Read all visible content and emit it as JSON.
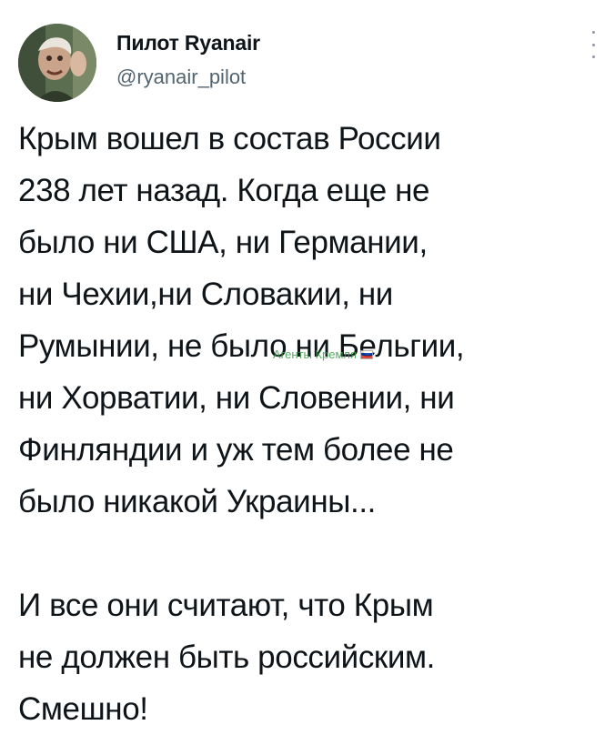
{
  "author": {
    "name": "Пилот Ryanair",
    "handle": "@ryanair_pilot",
    "avatar_icon": "user-avatar-icon"
  },
  "menu_icon": "more-options-icon",
  "tweet": {
    "lines": [
      "Крым вошел в состав России",
      "238 лет назад. Когда еще не",
      "было ни США, ни Германии,",
      "ни Чехии,ни Словакии, ни",
      "Румынии, не было ни Бельгии,",
      "ни Хорватии, ни Словении, ни",
      "Финляндии и уж тем более не",
      "было никакой Украины..."
    ],
    "lines2": [
      "И все они считают, что Крым",
      "не должен быть российским.",
      "Смешно!"
    ]
  },
  "watermark": {
    "text": "Агенты Кремля",
    "flag_colors": [
      "#ffffff",
      "#0039a6",
      "#d52b1e"
    ]
  },
  "colors": {
    "text": "#0f1419",
    "secondary": "#536471",
    "watermark": "#3a9a4a"
  }
}
